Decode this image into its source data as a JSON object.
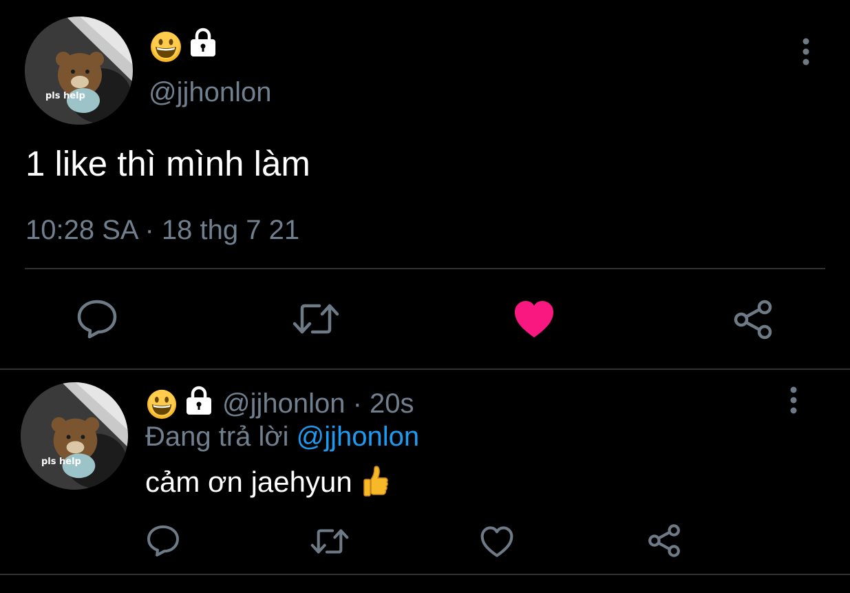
{
  "main_tweet": {
    "avatar_caption": "pls help",
    "display_name_icons": [
      "grinning-face-emoji",
      "lock-icon"
    ],
    "handle": "@jjhonlon",
    "text": "1 like thì mình làm",
    "timestamp": "10:28 SA · 18 thg 7 21",
    "actions": [
      "reply-icon",
      "retweet-icon",
      "like-icon-filled",
      "share-icon"
    ],
    "liked": true,
    "like_color": "#f91880"
  },
  "reply_tweet": {
    "avatar_caption": "pls help",
    "display_name_icons": [
      "grinning-face-emoji",
      "lock-icon"
    ],
    "handle_time": "@jjhonlon · 20s",
    "replying_prefix": "Đang trả lời",
    "replying_to": "@jjhonlon",
    "text": "cảm ơn jaehyun",
    "text_emoji": "thumbs-up-emoji",
    "actions": [
      "reply-icon",
      "retweet-icon",
      "like-icon",
      "share-icon"
    ]
  },
  "colors": {
    "background": "#000000",
    "muted_text": "#71808e",
    "link": "#1d9bf0",
    "divider": "#2f3336"
  }
}
